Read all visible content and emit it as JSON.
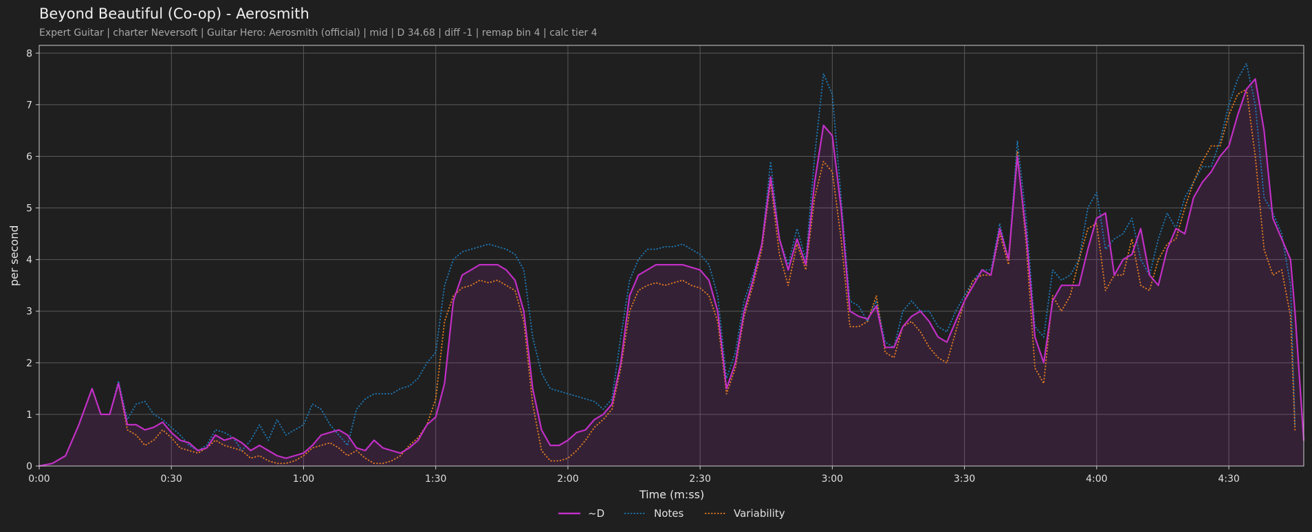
{
  "header": {
    "title": "Beyond Beautiful (Co-op) - Aerosmith",
    "subtitle": "Expert Guitar  |  charter Neversoft  |  Guitar Hero: Aerosmith (official)  |  mid  |  D 34.68  |  diff -1  |  remap bin 4  |  calc tier 4"
  },
  "chart_data": {
    "type": "line",
    "xlabel": "Time (m:ss)",
    "ylabel": "per second",
    "xlim": [
      0,
      287
    ],
    "ylim": [
      0,
      8.15
    ],
    "xticks": [
      {
        "value": 0,
        "label": "0:00"
      },
      {
        "value": 30,
        "label": "0:30"
      },
      {
        "value": 60,
        "label": "1:00"
      },
      {
        "value": 90,
        "label": "1:30"
      },
      {
        "value": 120,
        "label": "2:00"
      },
      {
        "value": 150,
        "label": "2:30"
      },
      {
        "value": 180,
        "label": "3:00"
      },
      {
        "value": 210,
        "label": "3:30"
      },
      {
        "value": 240,
        "label": "4:00"
      },
      {
        "value": 270,
        "label": "4:30"
      }
    ],
    "yticks": [
      0,
      1,
      2,
      3,
      4,
      5,
      6,
      7,
      8
    ],
    "grid": true,
    "legend_position": "bottom",
    "x": [
      0,
      3,
      6,
      9,
      12,
      14,
      16,
      18,
      20,
      22,
      24,
      26,
      28,
      30,
      32,
      34,
      36,
      38,
      40,
      42,
      44,
      46,
      48,
      50,
      52,
      54,
      56,
      58,
      60,
      62,
      64,
      66,
      68,
      70,
      72,
      74,
      76,
      78,
      80,
      82,
      84,
      86,
      88,
      90,
      92,
      94,
      96,
      98,
      100,
      102,
      104,
      106,
      108,
      110,
      112,
      114,
      116,
      118,
      120,
      122,
      124,
      126,
      128,
      130,
      132,
      134,
      136,
      138,
      140,
      142,
      144,
      146,
      148,
      150,
      152,
      154,
      156,
      158,
      160,
      162,
      164,
      166,
      168,
      170,
      172,
      174,
      176,
      178,
      180,
      182,
      184,
      186,
      188,
      190,
      192,
      194,
      196,
      198,
      200,
      202,
      204,
      206,
      208,
      210,
      212,
      214,
      216,
      218,
      220,
      222,
      224,
      226,
      228,
      230,
      232,
      234,
      236,
      238,
      240,
      242,
      244,
      246,
      248,
      250,
      252,
      254,
      256,
      258,
      260,
      262,
      264,
      266,
      268,
      270,
      272,
      274,
      276,
      278,
      280,
      282,
      284,
      285,
      287
    ],
    "series": [
      {
        "name": "~D",
        "color": "#c22fc6",
        "style": "solid",
        "values": [
          0,
          0.05,
          0.2,
          0.8,
          1.5,
          1.0,
          1.0,
          1.6,
          0.8,
          0.8,
          0.7,
          0.75,
          0.85,
          0.65,
          0.5,
          0.45,
          0.3,
          0.35,
          0.6,
          0.5,
          0.55,
          0.45,
          0.3,
          0.4,
          0.3,
          0.2,
          0.15,
          0.2,
          0.25,
          0.4,
          0.6,
          0.65,
          0.7,
          0.6,
          0.35,
          0.3,
          0.5,
          0.35,
          0.3,
          0.25,
          0.35,
          0.5,
          0.8,
          0.95,
          1.6,
          3.2,
          3.7,
          3.8,
          3.9,
          3.9,
          3.9,
          3.8,
          3.6,
          3.0,
          1.5,
          0.7,
          0.4,
          0.4,
          0.5,
          0.65,
          0.7,
          0.9,
          1.0,
          1.2,
          2.0,
          3.3,
          3.7,
          3.8,
          3.9,
          3.9,
          3.9,
          3.9,
          3.85,
          3.8,
          3.6,
          3.0,
          1.5,
          2.0,
          3.0,
          3.6,
          4.3,
          5.6,
          4.4,
          3.8,
          4.4,
          3.9,
          5.5,
          6.6,
          6.4,
          5.0,
          3.0,
          2.9,
          2.85,
          3.1,
          2.3,
          2.3,
          2.7,
          2.9,
          3.0,
          2.8,
          2.5,
          2.4,
          2.8,
          3.2,
          3.5,
          3.8,
          3.7,
          4.6,
          4.0,
          6.0,
          4.5,
          2.5,
          2.0,
          3.2,
          3.5,
          3.5,
          3.5,
          4.2,
          4.8,
          4.9,
          3.7,
          4.0,
          4.1,
          4.6,
          3.7,
          3.5,
          4.2,
          4.6,
          4.5,
          5.2,
          5.5,
          5.7,
          6.0,
          6.2,
          6.8,
          7.3,
          7.5,
          6.5,
          4.8,
          4.4,
          4.0,
          3.0,
          0.5
        ]
      },
      {
        "name": "Notes",
        "color": "#1f77b4",
        "style": "dotted",
        "values": [
          0,
          0.05,
          0.2,
          0.8,
          1.5,
          1.0,
          1.0,
          1.65,
          0.9,
          1.2,
          1.25,
          1.0,
          0.9,
          0.75,
          0.6,
          0.4,
          0.3,
          0.4,
          0.7,
          0.65,
          0.55,
          0.3,
          0.5,
          0.8,
          0.5,
          0.9,
          0.6,
          0.7,
          0.8,
          1.2,
          1.1,
          0.8,
          0.6,
          0.4,
          1.1,
          1.3,
          1.4,
          1.4,
          1.4,
          1.5,
          1.55,
          1.7,
          2.0,
          2.2,
          3.5,
          4.0,
          4.15,
          4.2,
          4.25,
          4.3,
          4.25,
          4.2,
          4.1,
          3.8,
          2.5,
          1.8,
          1.5,
          1.45,
          1.4,
          1.35,
          1.3,
          1.25,
          1.1,
          1.3,
          2.5,
          3.6,
          4.0,
          4.2,
          4.2,
          4.25,
          4.25,
          4.3,
          4.2,
          4.1,
          3.9,
          3.3,
          1.7,
          2.2,
          3.2,
          3.7,
          4.3,
          5.9,
          4.4,
          3.9,
          4.6,
          4.0,
          6.0,
          7.6,
          7.2,
          5.2,
          3.2,
          3.1,
          2.8,
          3.2,
          2.4,
          2.3,
          3.0,
          3.2,
          3.0,
          3.0,
          2.7,
          2.6,
          3.0,
          3.3,
          3.6,
          3.8,
          3.8,
          4.7,
          4.0,
          6.3,
          4.8,
          2.7,
          2.5,
          3.8,
          3.6,
          3.7,
          4.0,
          5.0,
          5.3,
          4.2,
          4.4,
          4.5,
          4.8,
          4.0,
          3.7,
          4.4,
          4.9,
          4.6,
          5.2,
          5.5,
          5.8,
          5.8,
          6.3,
          7.0,
          7.5,
          7.8,
          7.0,
          5.2,
          4.9,
          4.5,
          3.5,
          0.8
        ]
      },
      {
        "name": "Variability",
        "color": "#e07b22",
        "style": "dotted",
        "values": [
          0,
          0.05,
          0.2,
          0.8,
          1.5,
          1.0,
          1.0,
          1.6,
          0.7,
          0.6,
          0.4,
          0.5,
          0.7,
          0.55,
          0.35,
          0.3,
          0.25,
          0.35,
          0.5,
          0.4,
          0.35,
          0.3,
          0.15,
          0.2,
          0.1,
          0.05,
          0.05,
          0.1,
          0.2,
          0.35,
          0.4,
          0.45,
          0.35,
          0.2,
          0.3,
          0.15,
          0.05,
          0.05,
          0.1,
          0.2,
          0.4,
          0.55,
          0.8,
          1.3,
          2.8,
          3.3,
          3.45,
          3.5,
          3.6,
          3.55,
          3.6,
          3.5,
          3.4,
          2.8,
          1.2,
          0.3,
          0.1,
          0.1,
          0.15,
          0.3,
          0.5,
          0.75,
          0.9,
          1.1,
          1.9,
          3.0,
          3.4,
          3.5,
          3.55,
          3.5,
          3.55,
          3.6,
          3.5,
          3.45,
          3.3,
          2.8,
          1.4,
          1.9,
          2.9,
          3.5,
          4.2,
          5.5,
          4.1,
          3.5,
          4.3,
          3.8,
          5.2,
          5.9,
          5.7,
          4.4,
          2.7,
          2.7,
          2.8,
          3.3,
          2.2,
          2.1,
          2.7,
          2.8,
          2.6,
          2.3,
          2.1,
          2.0,
          2.6,
          3.2,
          3.6,
          3.7,
          3.7,
          4.5,
          3.9,
          6.1,
          4.3,
          1.9,
          1.6,
          3.3,
          3.0,
          3.3,
          4.0,
          4.6,
          4.7,
          3.4,
          3.7,
          3.7,
          4.4,
          3.5,
          3.4,
          4.0,
          4.3,
          4.4,
          5.0,
          5.5,
          5.9,
          6.2,
          6.2,
          6.8,
          7.2,
          7.3,
          6.0,
          4.2,
          3.7,
          3.8,
          2.9,
          0.7
        ]
      }
    ]
  }
}
